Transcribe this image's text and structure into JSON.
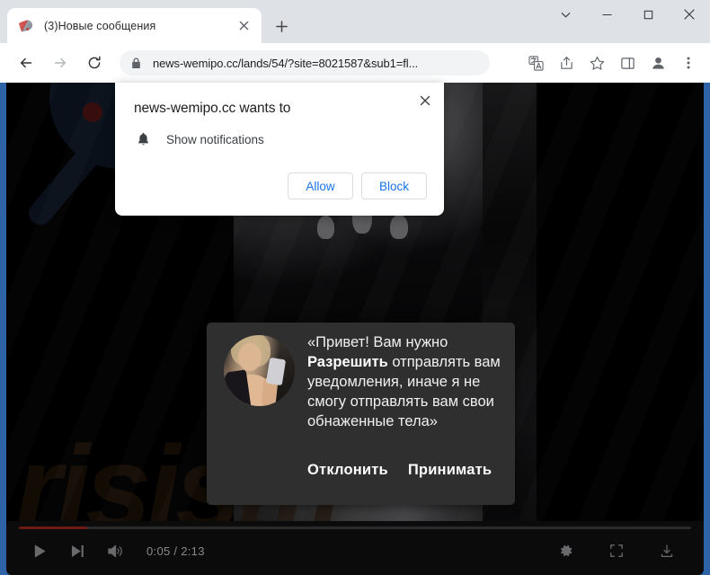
{
  "browser": {
    "tab": {
      "title": "(3)Новые сообщения",
      "favicon": "megaphone-icon",
      "close_icon": "close-icon"
    },
    "new_tab_icon": "plus-icon",
    "window_controls": {
      "tab_search_icon": "chevron-down-icon",
      "minimize_icon": "minimize-icon",
      "maximize_icon": "maximize-icon",
      "close_icon": "close-icon"
    },
    "toolbar": {
      "back_icon": "arrow-left-icon",
      "forward_icon": "arrow-right-icon",
      "reload_icon": "reload-icon",
      "lock_icon": "lock-icon",
      "url": "news-wemipo.cc/lands/54/?site=8021587&sub1=fl...",
      "actions": {
        "translate_icon": "translate-icon",
        "share_icon": "share-icon",
        "bookmark_icon": "star-icon",
        "side_panel_icon": "side-panel-icon",
        "profile_icon": "person-icon",
        "menu_icon": "three-dots-icon"
      }
    }
  },
  "permission_dialog": {
    "title": "news-wemipo.cc wants to",
    "permission_icon": "bell-icon",
    "permission_label": "Show notifications",
    "allow_label": "Allow",
    "block_label": "Block",
    "close_icon": "close-icon",
    "accent_color": "#1a73e8"
  },
  "push_popup": {
    "avatar": "woman-selfie-avatar",
    "message_prefix": "«Привет! Вам нужно ",
    "message_bold": "Разрешить",
    "message_suffix": " отправлять вам уведомления, иначе я не смогу отправлять вам свои обнаженные тела»",
    "decline_label": "Отклонить",
    "accept_label": "Принимать"
  },
  "video_player": {
    "watermark_text": "risism",
    "play_icon": "play-icon",
    "next_icon": "next-track-icon",
    "volume_icon": "volume-icon",
    "time_current": "0:05",
    "time_total": "2:13",
    "time_display": "0:05 / 2:13",
    "settings_icon": "gear-icon",
    "fullscreen_icon": "fullscreen-icon",
    "download_icon": "download-icon",
    "progress_percent": 10,
    "progress_color": "#6f1a16"
  }
}
